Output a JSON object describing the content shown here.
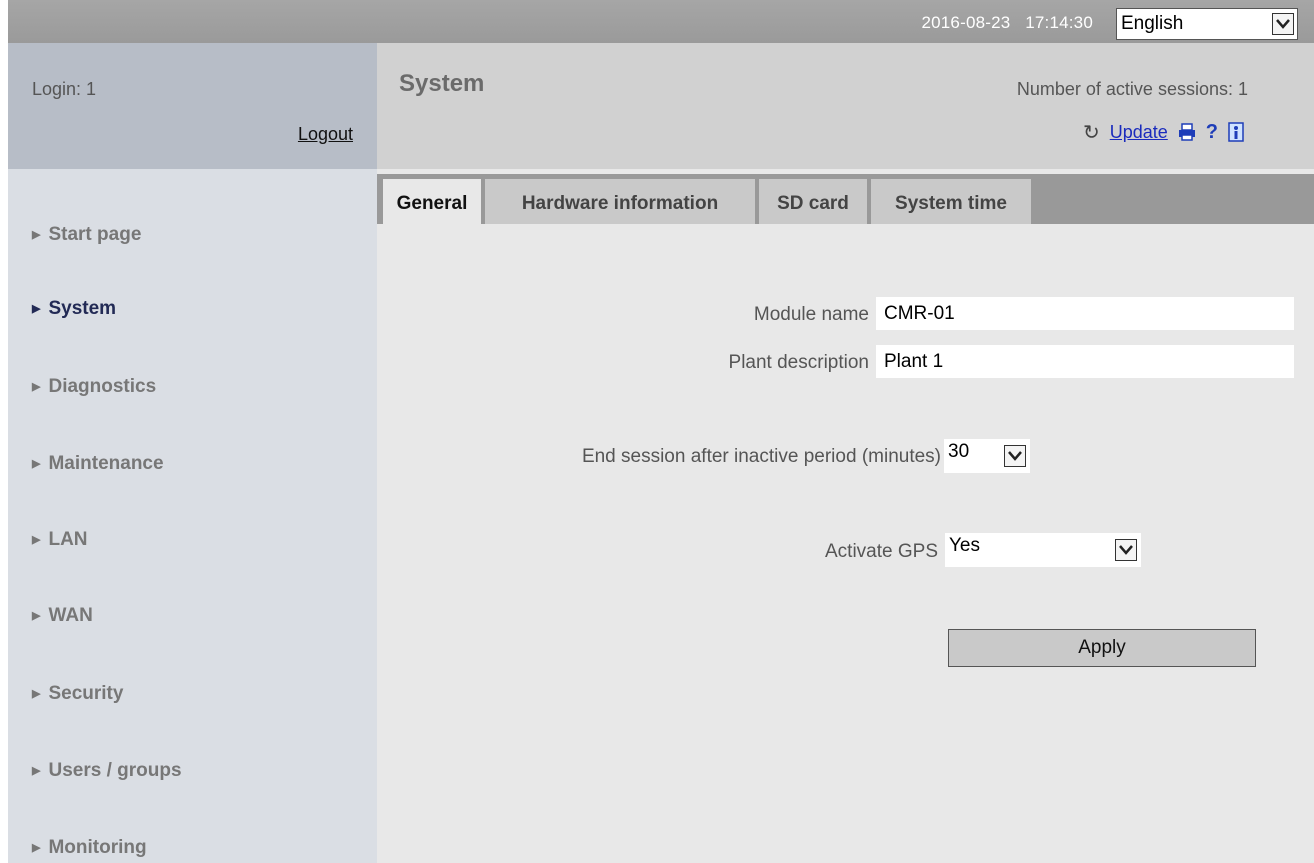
{
  "topbar": {
    "date": "2016-08-23",
    "time": "17:14:30",
    "language": "English"
  },
  "login": {
    "user_label": "Login: 1",
    "logout_label": "Logout"
  },
  "nav": {
    "items": [
      {
        "label": "Start page",
        "active": false
      },
      {
        "label": "System",
        "active": true
      },
      {
        "label": "Diagnostics",
        "active": false
      },
      {
        "label": "Maintenance",
        "active": false
      },
      {
        "label": "LAN",
        "active": false
      },
      {
        "label": "WAN",
        "active": false
      },
      {
        "label": "Security",
        "active": false
      },
      {
        "label": "Users / groups",
        "active": false
      },
      {
        "label": "Monitoring",
        "active": false
      }
    ]
  },
  "header": {
    "title": "System",
    "sessions": "Number of active sessions: 1",
    "update_label": "Update",
    "help_glyph": "?"
  },
  "tabs": [
    {
      "label": "General",
      "active": true
    },
    {
      "label": "Hardware information",
      "active": false
    },
    {
      "label": "SD card",
      "active": false
    },
    {
      "label": "System time",
      "active": false
    }
  ],
  "form": {
    "module_name_label": "Module name",
    "module_name_value": "CMR-01",
    "plant_description_label": "Plant description",
    "plant_description_value": "Plant 1",
    "session_timeout_label": "End session after inactive period (minutes)",
    "session_timeout_value": "30",
    "gps_label": "Activate GPS",
    "gps_value": "Yes",
    "apply_label": "Apply"
  },
  "colors": {
    "topbar": "#9e9e9e",
    "sidebar": "#dadee4",
    "login_box": "#b7bdc7",
    "header": "#d1d1d1",
    "content": "#e8e8e8",
    "active_nav": "#222a55",
    "link": "#1a2bbd"
  },
  "icons": [
    "chevron-down-icon",
    "refresh-icon",
    "print-icon",
    "help-icon",
    "info-icon",
    "arrow-right-icon"
  ]
}
